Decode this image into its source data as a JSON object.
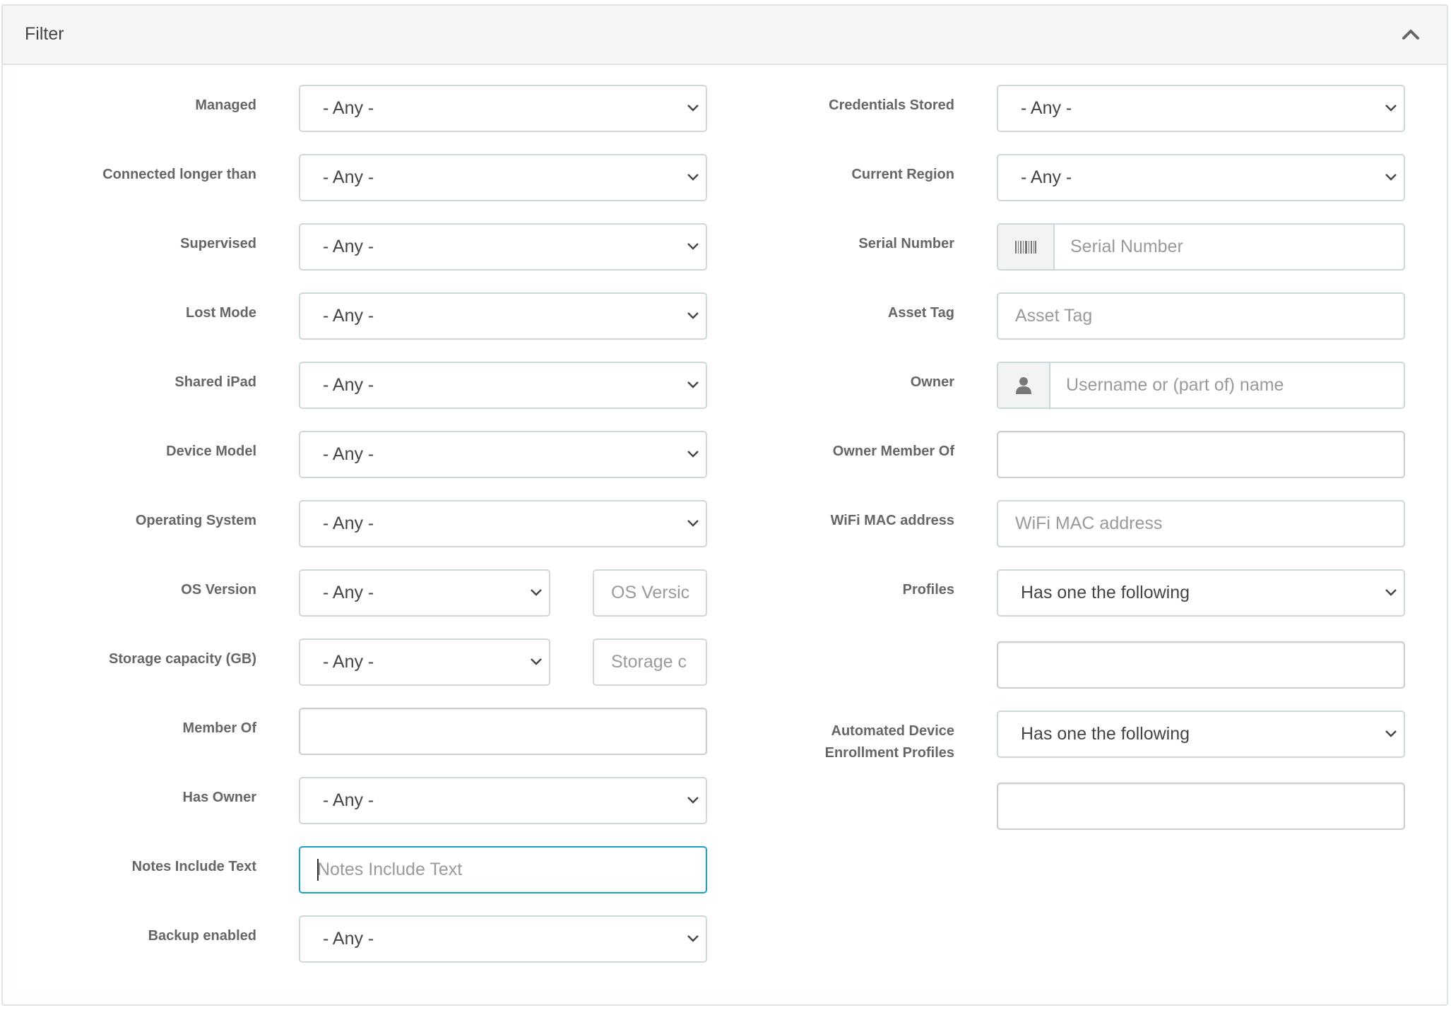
{
  "panel": {
    "title": "Filter"
  },
  "left": {
    "managed": {
      "label": "Managed",
      "value": "- Any -"
    },
    "connected": {
      "label": "Connected longer than",
      "value": "- Any -"
    },
    "supervised": {
      "label": "Supervised",
      "value": "- Any -"
    },
    "lost_mode": {
      "label": "Lost Mode",
      "value": "- Any -"
    },
    "shared_ipad": {
      "label": "Shared iPad",
      "value": "- Any -"
    },
    "device_model": {
      "label": "Device Model",
      "value": "- Any -"
    },
    "os": {
      "label": "Operating System",
      "value": "- Any -"
    },
    "os_version": {
      "label": "OS Version",
      "value": "- Any -",
      "placeholder": "OS Versic"
    },
    "storage": {
      "label": "Storage capacity (GB)",
      "value": "- Any -",
      "placeholder": "Storage c"
    },
    "member_of": {
      "label": "Member Of"
    },
    "has_owner": {
      "label": "Has Owner",
      "value": "- Any -"
    },
    "notes": {
      "label": "Notes Include Text",
      "placeholder": "Notes Include Text"
    },
    "backup": {
      "label": "Backup enabled",
      "value": "- Any -"
    }
  },
  "right": {
    "credentials": {
      "label": "Credentials Stored",
      "value": "- Any -"
    },
    "region": {
      "label": "Current Region",
      "value": "- Any -"
    },
    "serial": {
      "label": "Serial Number",
      "placeholder": "Serial Number"
    },
    "asset_tag": {
      "label": "Asset Tag",
      "placeholder": "Asset Tag"
    },
    "owner": {
      "label": "Owner",
      "placeholder": "Username or (part of) name"
    },
    "owner_member_of": {
      "label": "Owner Member Of"
    },
    "wifi_mac": {
      "label": "WiFi MAC address",
      "placeholder": "WiFi MAC address"
    },
    "profiles": {
      "label": "Profiles",
      "value": "Has one the following"
    },
    "ade_profiles": {
      "label_line1": "Automated Device",
      "label_line2": "Enrollment Profiles",
      "value": "Has one the following"
    }
  }
}
